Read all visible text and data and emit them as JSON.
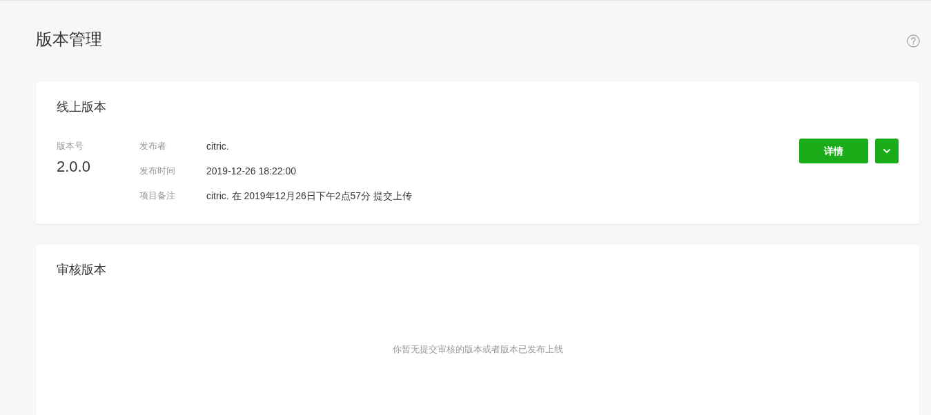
{
  "page": {
    "title": "版本管理"
  },
  "online_version": {
    "title": "线上版本",
    "version_label": "版本号",
    "version": "2.0.0",
    "fields": [
      {
        "label": "发布者",
        "value": "citric."
      },
      {
        "label": "发布时间",
        "value": "2019-12-26 18:22:00"
      },
      {
        "label": "项目备注",
        "value": "citric. 在 2019年12月26日下午2点57分 提交上传"
      }
    ],
    "details_button": "详情"
  },
  "review_version": {
    "title": "审核版本",
    "empty_message": "你暂无提交审核的版本或者版本已发布上线"
  }
}
